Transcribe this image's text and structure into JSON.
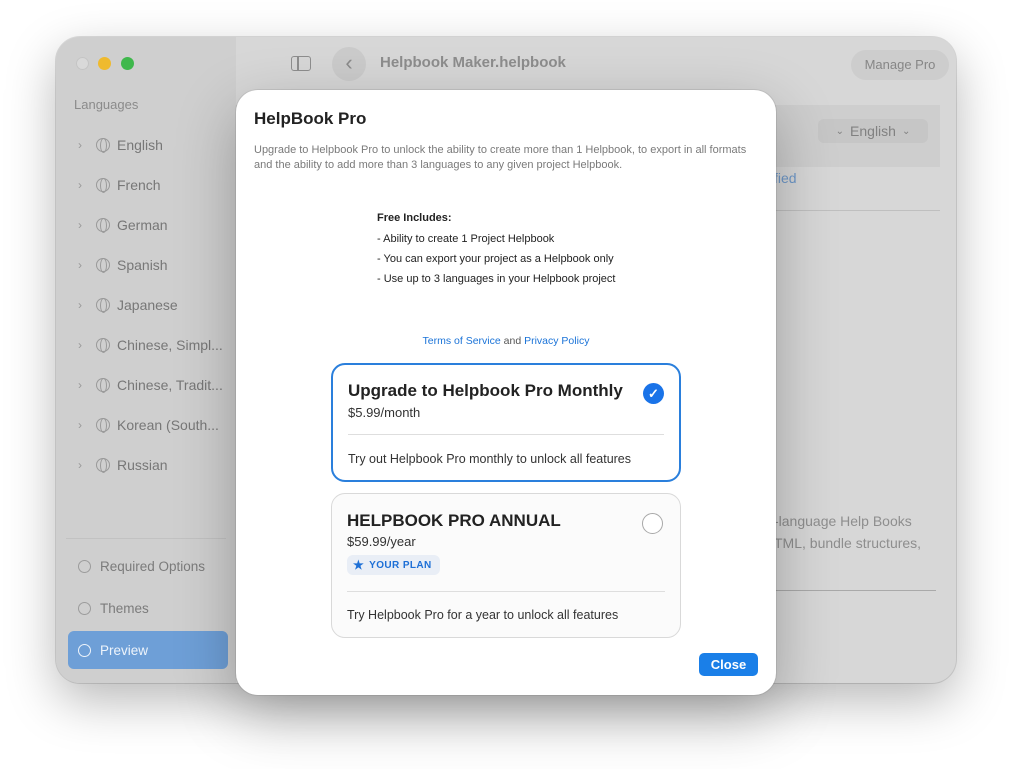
{
  "window": {
    "title": "Helpbook Maker.helpbook",
    "manage_pro_label": "Manage Pro",
    "language_select": "English",
    "partial_link": "fied",
    "bg_text_lines": [
      "-language Help Books",
      "TML, bundle structures,"
    ]
  },
  "sidebar": {
    "heading": "Languages",
    "languages": [
      {
        "label": "English"
      },
      {
        "label": "French"
      },
      {
        "label": "German"
      },
      {
        "label": "Spanish"
      },
      {
        "label": "Japanese"
      },
      {
        "label": "Chinese, Simpl..."
      },
      {
        "label": "Chinese, Tradit..."
      },
      {
        "label": "Korean (South..."
      },
      {
        "label": "Russian"
      }
    ],
    "bottom_items": [
      {
        "label": "Required Options",
        "icon": "gear-icon"
      },
      {
        "label": "Themes",
        "icon": "palette-icon"
      },
      {
        "label": "Preview",
        "icon": "eye-icon",
        "selected": true
      }
    ]
  },
  "modal": {
    "title": "HelpBook Pro",
    "description": "Upgrade to Helpbook Pro to unlock the ability to create more than 1 Helpbook, to export in all formats and the ability to add more than 3 languages to any given project Helpbook.",
    "includes_heading": "Free Includes:",
    "includes": [
      "- Ability to create 1 Project Helpbook",
      "- You can export your project as a Helpbook only",
      "- Use up to 3 languages in your Helpbook project"
    ],
    "terms_label": "Terms of Service",
    "and_label": "and",
    "privacy_label": "Privacy Policy",
    "plans": [
      {
        "name": "Upgrade to Helpbook Pro Monthly",
        "price": "$5.99/month",
        "description": "Try out Helpbook Pro monthly to unlock all features",
        "selected": true
      },
      {
        "name": "HELPBOOK PRO ANNUAL",
        "price": "$59.99/year",
        "badge": "YOUR PLAN",
        "description": "Try Helpbook Pro for a year to unlock all features",
        "selected": false
      }
    ],
    "close_label": "Close"
  },
  "colors": {
    "accent": "#1a73e8",
    "sidebar_selected": "#6e9fd7"
  }
}
